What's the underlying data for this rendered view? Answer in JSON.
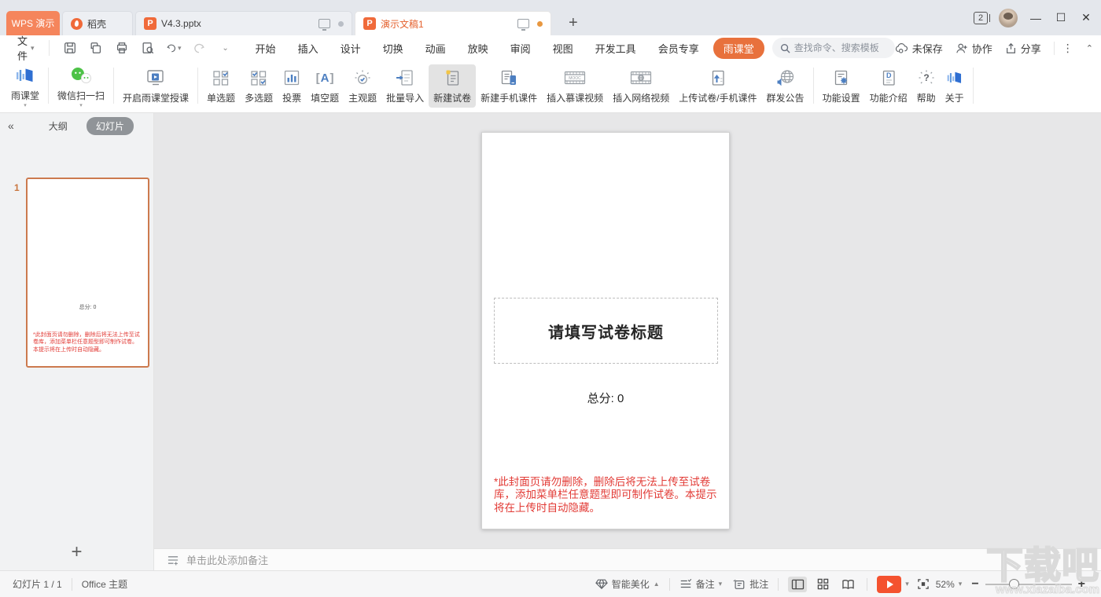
{
  "colors": {
    "accent_orange": "#f5855c",
    "pill_orange": "#e8713c",
    "play_orange": "#f4522f",
    "icon_blue": "#4d7fc1",
    "wechat_green": "#4dc247",
    "warning_red": "#e23b36"
  },
  "titlebar": {
    "app_tab": "WPS 演示",
    "doc_tabs": [
      {
        "label": "稻壳"
      },
      {
        "label": "V4.3.pptx"
      },
      {
        "label": "演示文稿1"
      }
    ],
    "new_tab": "+",
    "window_count": "2"
  },
  "menubar": {
    "file": "文件",
    "items": [
      "开始",
      "插入",
      "设计",
      "切换",
      "动画",
      "放映",
      "审阅",
      "视图",
      "开发工具",
      "会员专享"
    ],
    "active_tab": "雨课堂",
    "search_placeholder": "查找命令、搜索模板",
    "save_status": "未保存",
    "collaborate": "协作",
    "share": "分享"
  },
  "ribbon": {
    "buttons": [
      {
        "label": "雨课堂"
      },
      {
        "label": "微信扫一扫"
      },
      {
        "label": "开启雨课堂授课"
      },
      {
        "label": "单选题"
      },
      {
        "label": "多选题"
      },
      {
        "label": "投票"
      },
      {
        "label": "填空题"
      },
      {
        "label": "主观题"
      },
      {
        "label": "批量导入"
      },
      {
        "label": "新建试卷"
      },
      {
        "label": "新建手机课件"
      },
      {
        "label": "插入慕课视频"
      },
      {
        "label": "插入网络视频"
      },
      {
        "label": "上传试卷/手机课件"
      },
      {
        "label": "群发公告"
      },
      {
        "label": "功能设置"
      },
      {
        "label": "功能介绍"
      },
      {
        "label": "帮助"
      },
      {
        "label": "关于"
      }
    ],
    "mooc_badge": "MOOC"
  },
  "slides_panel": {
    "collapse": "«",
    "outline_tab": "大纲",
    "slides_tab": "幻灯片",
    "slide_number": "1",
    "thumbnail": {
      "score": "总分: 0",
      "warning": "*此封面页请勿删除，删除后将无法上传至试卷库，添加菜单栏任意题型即可制作试卷。本提示将在上传时自动隐藏。"
    },
    "add_slide": "+"
  },
  "slide": {
    "title_placeholder": "请填写试卷标题",
    "score": "总分: 0",
    "warning": "*此封面页请勿删除，删除后将无法上传至试卷库，添加菜单栏任意题型即可制作试卷。本提示将在上传时自动隐藏。"
  },
  "notes": {
    "placeholder": "单击此处添加备注"
  },
  "statusbar": {
    "slide_counter": "幻灯片 1 / 1",
    "theme": "Office 主题",
    "beautify": "智能美化",
    "notes_label": "备注",
    "comments_label": "批注",
    "zoom_level": "52%"
  },
  "watermark": {
    "logo": "下载吧",
    "url": "www.xiazaiba.com"
  }
}
